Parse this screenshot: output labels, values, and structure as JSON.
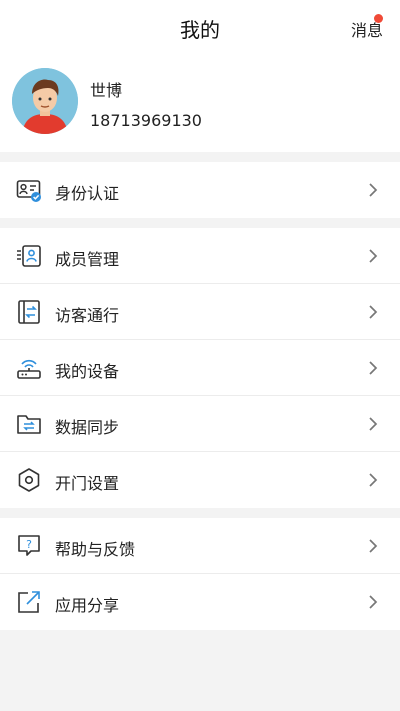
{
  "header": {
    "title": "我的",
    "message_label": "消息",
    "badge_color": "#f04a37"
  },
  "profile": {
    "name": "世博",
    "phone": "18713969130"
  },
  "groups": [
    [
      {
        "label": "身份认证",
        "icon": "id-card-icon"
      }
    ],
    [
      {
        "label": "成员管理",
        "icon": "members-icon"
      },
      {
        "label": "访客通行",
        "icon": "visitor-pass-icon"
      },
      {
        "label": "我的设备",
        "icon": "router-device-icon"
      },
      {
        "label": "数据同步",
        "icon": "folder-sync-icon"
      },
      {
        "label": "开门设置",
        "icon": "hexagon-settings-icon"
      }
    ],
    [
      {
        "label": "帮助与反馈",
        "icon": "help-feedback-icon"
      },
      {
        "label": "应用分享",
        "icon": "share-icon"
      }
    ]
  ],
  "colors": {
    "accent": "#2f8fdc",
    "icon_stroke": "#333333"
  }
}
